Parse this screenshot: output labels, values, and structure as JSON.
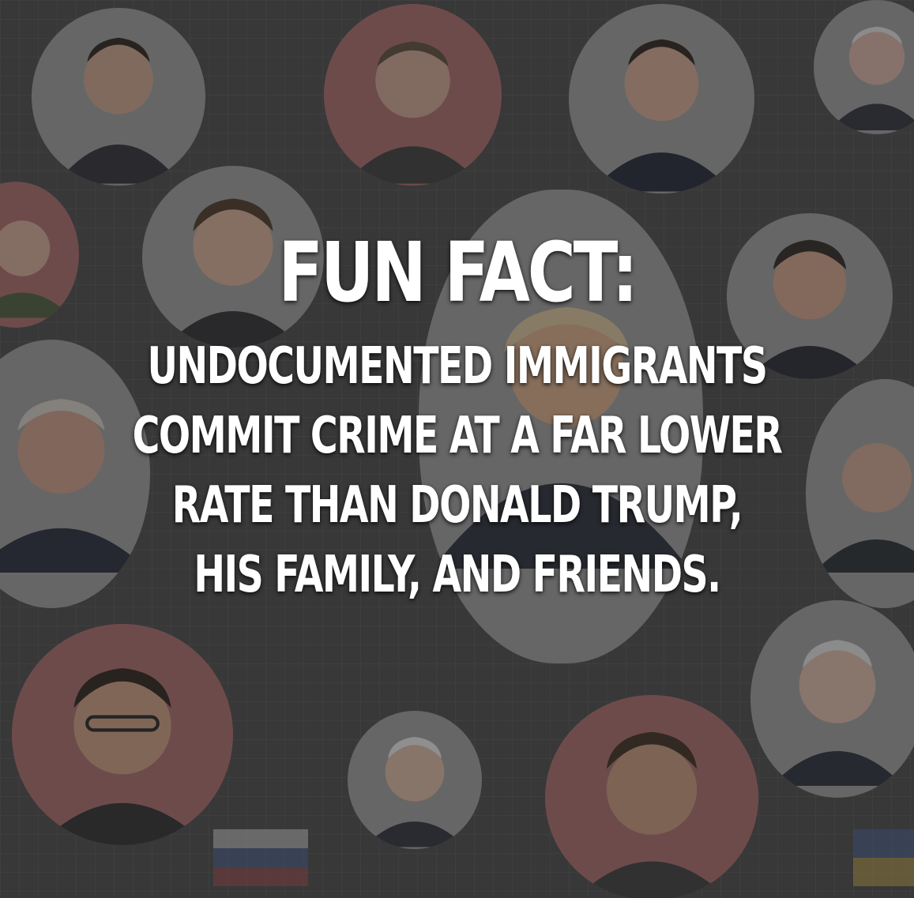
{
  "headline": "FUN FACT:",
  "lines": [
    "UNDOCUMENTED IMMIGRANTS",
    "COMMIT CRIME AT A FAR LOWER",
    "RATE THAN DONALD TRUMP,",
    "HIS FAMILY, AND FRIENDS."
  ],
  "colors": {
    "text": "#ffffff",
    "background": "#454545",
    "circle_pink": "#a86868",
    "circle_grey": "#9a9a9a"
  }
}
